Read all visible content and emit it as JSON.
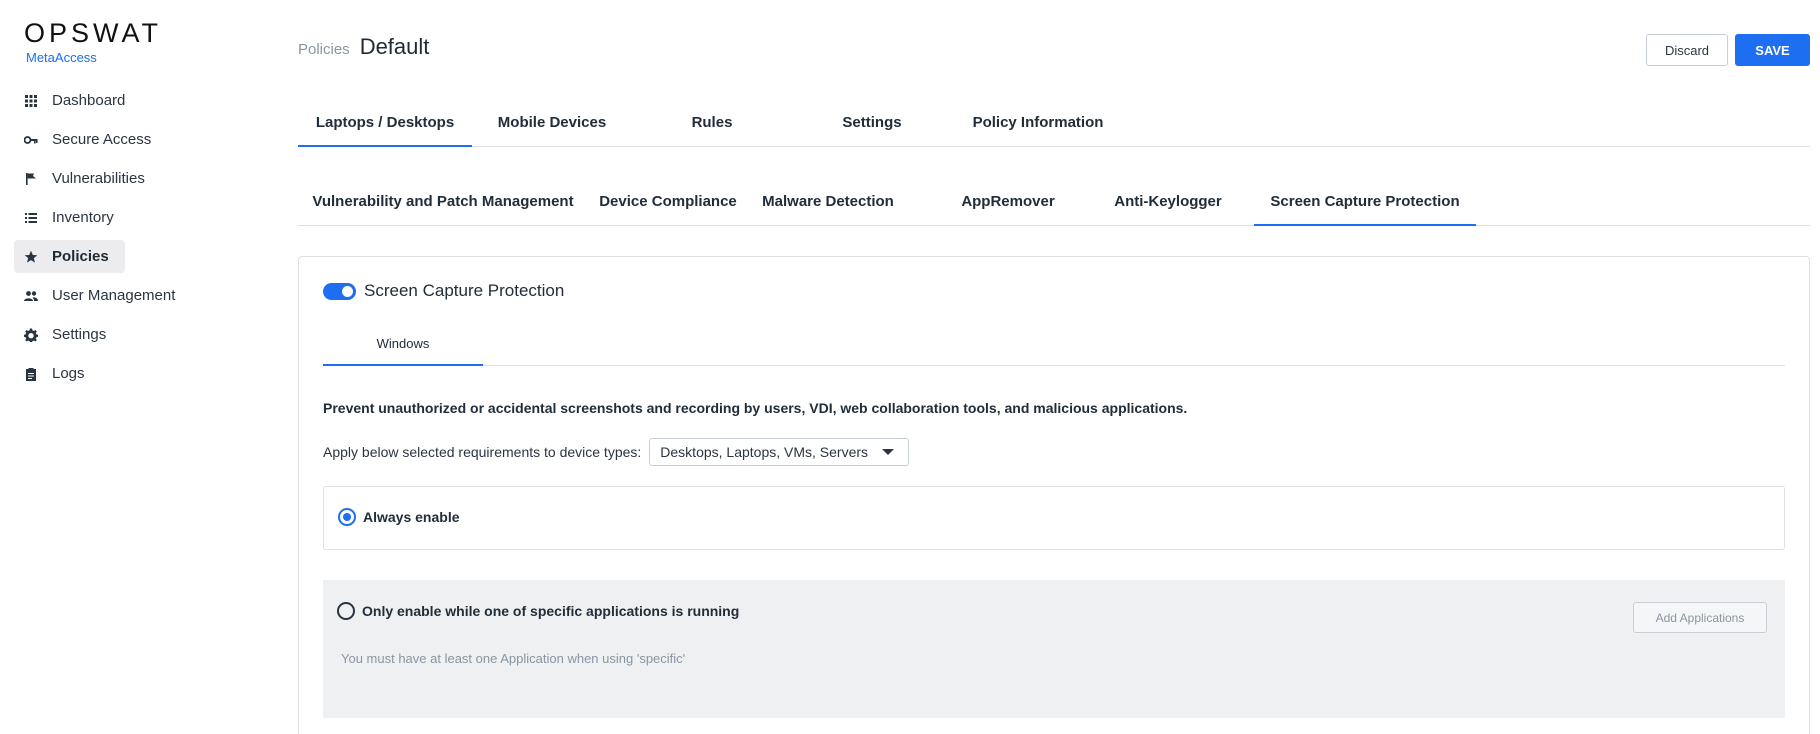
{
  "brand": {
    "name": "OPSWAT",
    "product": "MetaAccess"
  },
  "sidebar": {
    "items": [
      {
        "label": "Dashboard",
        "icon": "grid-icon"
      },
      {
        "label": "Secure Access",
        "icon": "key-icon"
      },
      {
        "label": "Vulnerabilities",
        "icon": "flag-icon"
      },
      {
        "label": "Inventory",
        "icon": "list-icon"
      },
      {
        "label": "Policies",
        "icon": "star-icon",
        "active": true
      },
      {
        "label": "User Management",
        "icon": "users-icon"
      },
      {
        "label": "Settings",
        "icon": "gear-icon"
      },
      {
        "label": "Logs",
        "icon": "clipboard-icon"
      }
    ]
  },
  "header": {
    "breadcrumb_parent": "Policies",
    "title": "Default",
    "discard_label": "Discard",
    "save_label": "SAVE"
  },
  "primary_tabs": [
    {
      "label": "Laptops / Desktops",
      "active": true
    },
    {
      "label": "Mobile Devices"
    },
    {
      "label": "Rules"
    },
    {
      "label": "Settings"
    },
    {
      "label": "Policy Information"
    }
  ],
  "secondary_tabs": [
    {
      "label": "Vulnerability and Patch Management"
    },
    {
      "label": "Device Compliance"
    },
    {
      "label": "Malware Detection"
    },
    {
      "label": "AppRemover"
    },
    {
      "label": "Anti-Keylogger"
    },
    {
      "label": "Screen Capture Protection",
      "active": true
    }
  ],
  "panel": {
    "toggle_label": "Screen Capture Protection",
    "toggle_on": true,
    "os_tab": "Windows",
    "description": "Prevent unauthorized or accidental screenshots and recording by users, VDI, web collaboration tools, and malicious applications.",
    "apply_label": "Apply below selected requirements to device types:",
    "device_types_value": "Desktops, Laptops, VMs, Servers",
    "option_always": "Always enable",
    "option_specific": "Only enable while one of specific applications is running",
    "add_apps_label": "Add Applications",
    "specific_hint": "You must have at least one Application when using 'specific'"
  },
  "colors": {
    "accent": "#1d6ef0",
    "muted_panel": "#eff0f2"
  }
}
